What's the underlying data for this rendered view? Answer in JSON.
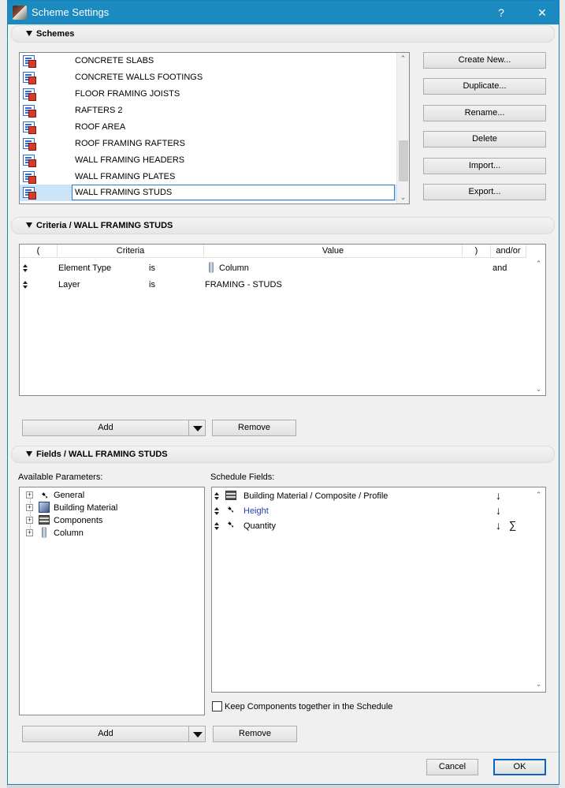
{
  "window": {
    "title": "Scheme Settings",
    "help_glyph": "?",
    "close_glyph": "✕"
  },
  "schemes": {
    "section_label": "Schemes",
    "items": [
      "CONCRETE SLABS",
      "CONCRETE WALLS  FOOTINGS",
      "FLOOR FRAMING JOISTS",
      "RAFTERS 2",
      "ROOF AREA",
      "ROOF FRAMING RAFTERS",
      "WALL FRAMING HEADERS",
      "WALL FRAMING PLATES"
    ],
    "editing_value": "WALL FRAMING STUDS",
    "buttons": {
      "create_new": "Create New...",
      "duplicate": "Duplicate...",
      "rename": "Rename...",
      "delete": "Delete",
      "import": "Import...",
      "export": "Export..."
    }
  },
  "criteria": {
    "section_label": "Criteria /  WALL FRAMING STUDS",
    "columns": {
      "open_paren": "(",
      "criteria": "Criteria",
      "value": "Value",
      "close_paren": ")",
      "andor": "and/or"
    },
    "rows": [
      {
        "criteria": "Element Type",
        "op": "is",
        "value": "Column",
        "andor": "and"
      },
      {
        "criteria": "Layer",
        "op": "is",
        "value": "FRAMING - STUDS",
        "andor": ""
      }
    ],
    "add_label": "Add",
    "remove_label": "Remove"
  },
  "fields": {
    "section_label": "Fields /  WALL FRAMING STUDS",
    "available_label": "Available Parameters:",
    "schedule_label": "Schedule Fields:",
    "available": [
      "General",
      "Building Material",
      "Components",
      "Column"
    ],
    "schedule": [
      {
        "name": "Building Material / Composite / Profile",
        "sort": "↓",
        "sum": ""
      },
      {
        "name": "Height",
        "sort": "↓",
        "sum": ""
      },
      {
        "name": "Quantity",
        "sort": "↓",
        "sum": "∑"
      }
    ],
    "keep_components_label": "Keep Components together in the Schedule",
    "keep_components_checked": false,
    "add_label": "Add",
    "remove_label": "Remove"
  },
  "footer": {
    "cancel_label": "Cancel",
    "ok_label": "OK"
  },
  "colors": {
    "title_bar": "#1a8ac0",
    "link_blue": "#1f3fb5",
    "selection_border": "#2a7ad8"
  }
}
